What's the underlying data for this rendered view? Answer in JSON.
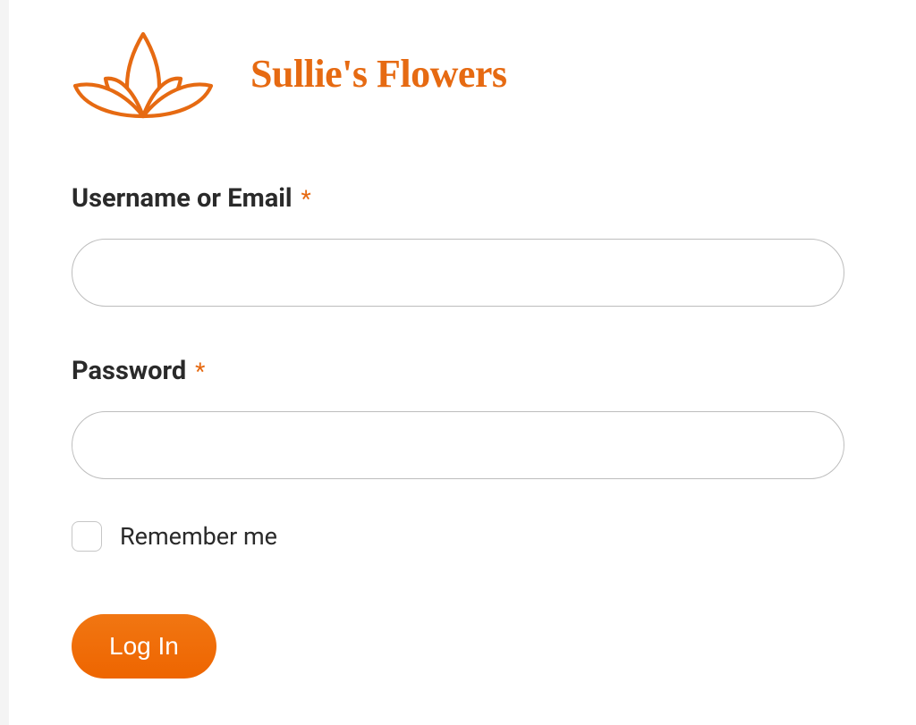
{
  "brand": {
    "name": "Sullie's Flowers",
    "color": "#e66a12"
  },
  "form": {
    "username": {
      "label": "Username or Email",
      "required_mark": "*",
      "value": ""
    },
    "password": {
      "label": "Password",
      "required_mark": "*",
      "value": ""
    },
    "remember": {
      "label": "Remember me",
      "checked": false
    },
    "submit": {
      "label": "Log In"
    }
  }
}
